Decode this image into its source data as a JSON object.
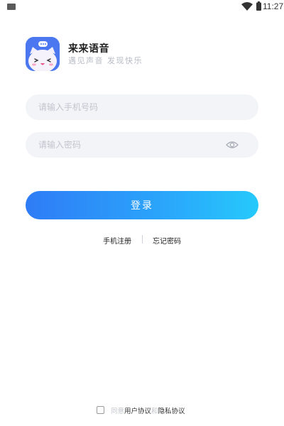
{
  "status_bar": {
    "time": "11:27",
    "icons": [
      "notification-icon",
      "wifi-icon",
      "battery-icon"
    ]
  },
  "brand": {
    "name": "来来语音",
    "slogan": "遇见声音 发现快乐",
    "logo_icon": "cat-mascot-icon",
    "logo_color": "#4b78f0"
  },
  "form": {
    "phone_placeholder": "请输入手机号码",
    "phone_value": "",
    "password_placeholder": "请输入密码",
    "password_value": "",
    "eye_icon": "eye-icon"
  },
  "login_button": {
    "label": "登录",
    "gradient_start": "#2f7cf6",
    "gradient_end": "#26c9fb"
  },
  "links": {
    "register": "手机注册",
    "forgot_password": "忘记密码"
  },
  "agreement": {
    "checked": false,
    "prefix": "同意",
    "user_agreement": "用户协议",
    "and": "和",
    "privacy_policy": "隐私协议"
  }
}
